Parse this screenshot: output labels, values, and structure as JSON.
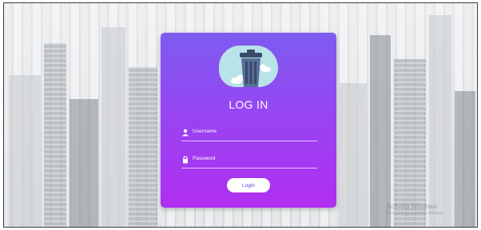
{
  "login": {
    "title": "LOG IN",
    "username_placeholder": "Username",
    "password_placeholder": "Password",
    "button_label": "Login"
  },
  "watermark": {
    "line1": "Activate Windows",
    "line2": "Go to Settings to activate Windows."
  },
  "icons": [
    "trash-bin-icon",
    "cloud-icon",
    "user-icon",
    "lock-icon"
  ],
  "colors": {
    "card_top": "#7d5cf0",
    "card_bottom": "#b12ef0",
    "accent_cloud": "#b8e3e8",
    "text": "#ffffff"
  }
}
